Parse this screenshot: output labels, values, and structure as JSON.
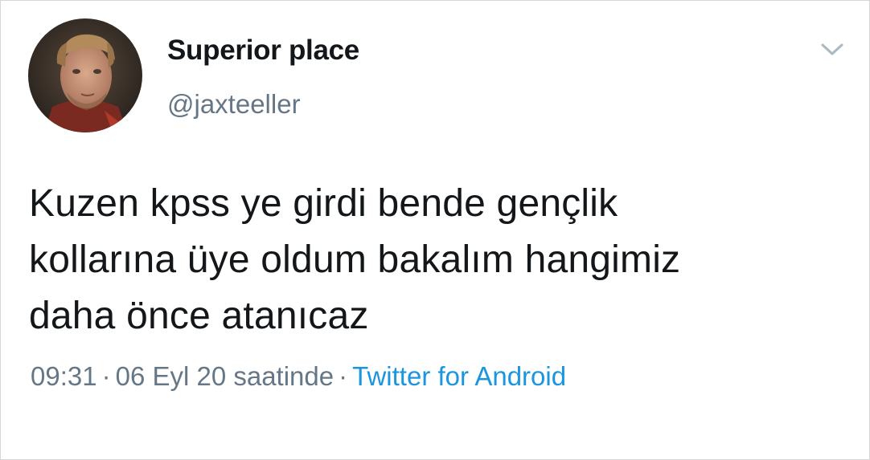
{
  "user": {
    "display_name": "Superior place",
    "handle": "@jaxteeller"
  },
  "tweet": {
    "lines": [
      "Kuzen kpss ye girdi bende gençlik",
      "kollarına üye oldum bakalım hangimiz",
      "daha önce atanıcaz"
    ]
  },
  "meta": {
    "time": "09:31",
    "separator": "·",
    "date": "06 Eyl 20 saatinde",
    "source": "Twitter for Android"
  },
  "colors": {
    "name": "#14171a",
    "muted": "#657786",
    "link": "#1b95e0"
  },
  "icons": {
    "more": "chevron-down-icon",
    "avatar": "profile-photo"
  }
}
